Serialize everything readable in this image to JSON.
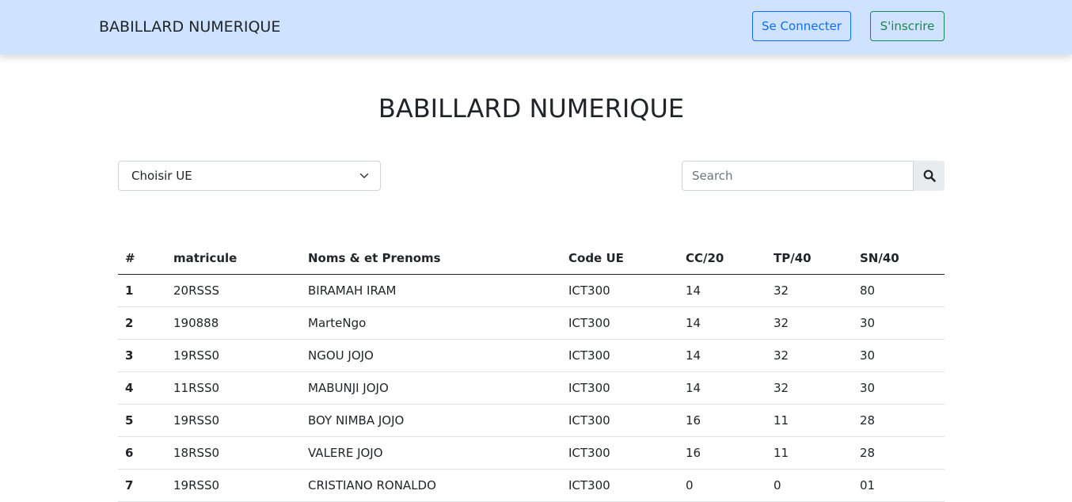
{
  "navbar": {
    "brand": "BABILLARD NUMERIQUE",
    "login_label": "Se Connecter",
    "register_label": "S'inscrire"
  },
  "page": {
    "title": "BABILLARD NUMERIQUE"
  },
  "filter": {
    "selected": "Choisir UE"
  },
  "search": {
    "placeholder": "Search",
    "value": ""
  },
  "table": {
    "headers": [
      "#",
      "matricule",
      "Noms & et Prenoms",
      "Code UE",
      "CC/20",
      "TP/40",
      "SN/40"
    ],
    "rows": [
      [
        "1",
        "20RSSS",
        "BIRAMAH IRAM",
        "ICT300",
        "14",
        "32",
        "80"
      ],
      [
        "2",
        "190888",
        "MarteNgo",
        "ICT300",
        "14",
        "32",
        "30"
      ],
      [
        "3",
        "19RSS0",
        "NGOU JOJO",
        "ICT300",
        "14",
        "32",
        "30"
      ],
      [
        "4",
        "11RSS0",
        "MABUNJI JOJO",
        "ICT300",
        "14",
        "32",
        "30"
      ],
      [
        "5",
        "19RSS0",
        "BOY NIMBA JOJO",
        "ICT300",
        "16",
        "11",
        "28"
      ],
      [
        "6",
        "18RSS0",
        "VALERE JOJO",
        "ICT300",
        "16",
        "11",
        "28"
      ],
      [
        "7",
        "19RSS0",
        "CRISTIANO RONALDO",
        "ICT300",
        "0",
        "0",
        "01"
      ]
    ]
  },
  "colors": {
    "navbar_bg": "#cfe2ff",
    "primary": "#0d6efd",
    "success": "#198754"
  },
  "icons": {
    "select": "chevron-down-icon",
    "search": "search-icon"
  }
}
